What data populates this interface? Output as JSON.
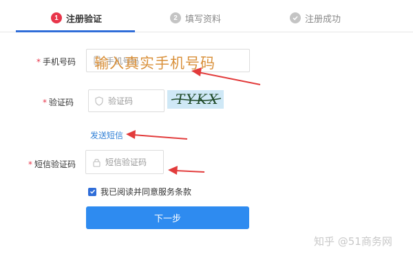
{
  "steps": [
    {
      "num": "1",
      "label": "注册验证"
    },
    {
      "num": "2",
      "label": "填写资料"
    },
    {
      "num": "",
      "label": "注册成功"
    }
  ],
  "form": {
    "phone": {
      "label": "手机号码",
      "placeholder": "手机号码",
      "overlay": "输入真实手机号码"
    },
    "captcha": {
      "label": "验证码",
      "placeholder": "验证码",
      "image_text": "TYKX"
    },
    "send_sms": "发送短信",
    "sms_code": {
      "label": "短信验证码",
      "placeholder": "短信验证码"
    },
    "required_mark": "*",
    "agree": "我已阅读并同意服务条款",
    "next": "下一步"
  },
  "watermark": "知乎 @51商务网",
  "colors": {
    "accent": "#2f6dd8",
    "button": "#2e8bf0",
    "required": "#e8354a",
    "arrow": "#e23b3b",
    "overlay_text": "#d9903a"
  }
}
